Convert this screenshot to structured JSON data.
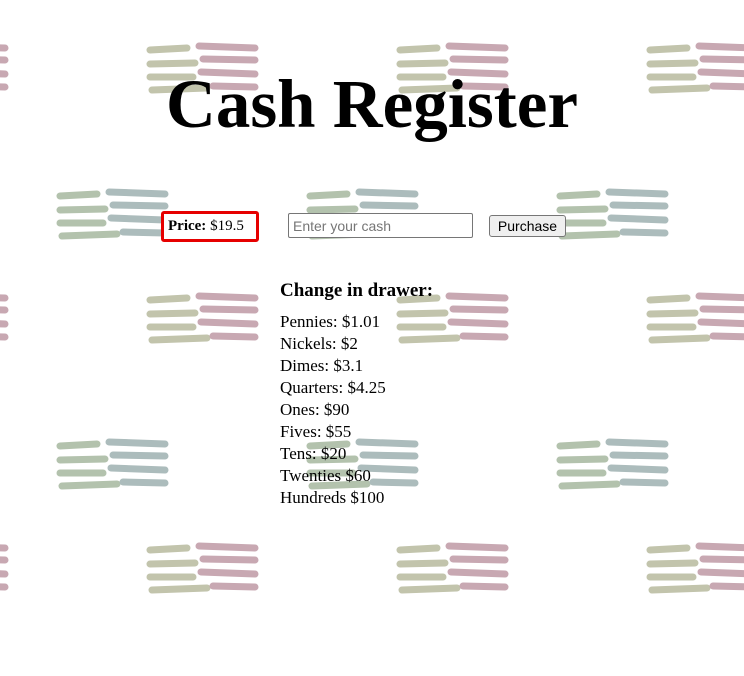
{
  "header": {
    "title": "Cash Register"
  },
  "price": {
    "label": "Price:",
    "value": "$19.5"
  },
  "cash_input": {
    "placeholder": "Enter your cash",
    "value": ""
  },
  "purchase_button": {
    "label": "Purchase"
  },
  "drawer": {
    "title": "Change in drawer:",
    "items": [
      "Pennies: $1.01",
      "Nickels: $2",
      "Dimes: $3.1",
      "Quarters: $4.25",
      "Ones: $90",
      "Fives: $55",
      "Tens: $20",
      "Twenties $60",
      "Hundreds $100"
    ]
  },
  "colors": {
    "background": "#ffffff",
    "price_border": "#e60000",
    "pattern_olive": "#c2c4ac",
    "pattern_mauve": "#c8a8b2",
    "pattern_green": "#b3c2ad",
    "pattern_slate": "#acbcbc"
  }
}
